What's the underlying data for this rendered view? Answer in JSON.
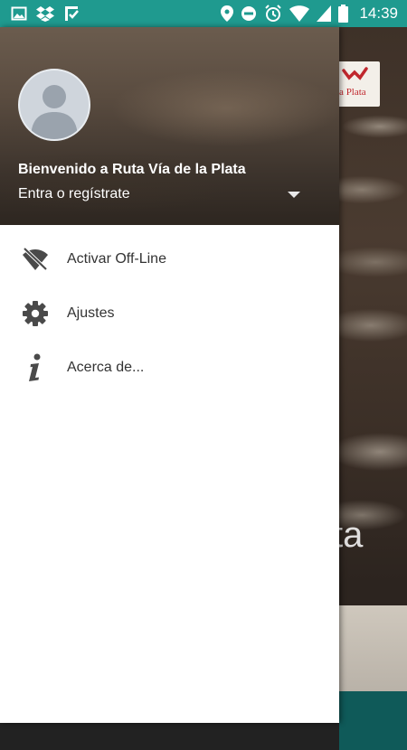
{
  "status_bar": {
    "time": "14:39",
    "left_icons": [
      "image-icon",
      "dropbox-icon",
      "check-flag-icon"
    ],
    "right_icons": [
      "location-icon",
      "do-not-disturb-icon",
      "alarm-icon",
      "wifi-icon",
      "signal-icon",
      "battery-icon"
    ]
  },
  "drawer": {
    "header": {
      "welcome": "Bienvenido a Ruta Vía de la Plata",
      "login": "Entra o regístrate"
    },
    "menu": [
      {
        "label": "Activar Off-Line",
        "icon": "wifi-off-icon"
      },
      {
        "label": "Ajustes",
        "icon": "settings-gear-icon"
      },
      {
        "label": "Acerca de...",
        "icon": "info-icon"
      }
    ]
  },
  "background": {
    "logo_text": "la Plata",
    "title_fragment": "ta"
  },
  "colors": {
    "status_bar": "#1f9a8f",
    "drawer_bg": "#ffffff",
    "menu_text": "#333333",
    "icon_gray": "#4a4a4a"
  }
}
